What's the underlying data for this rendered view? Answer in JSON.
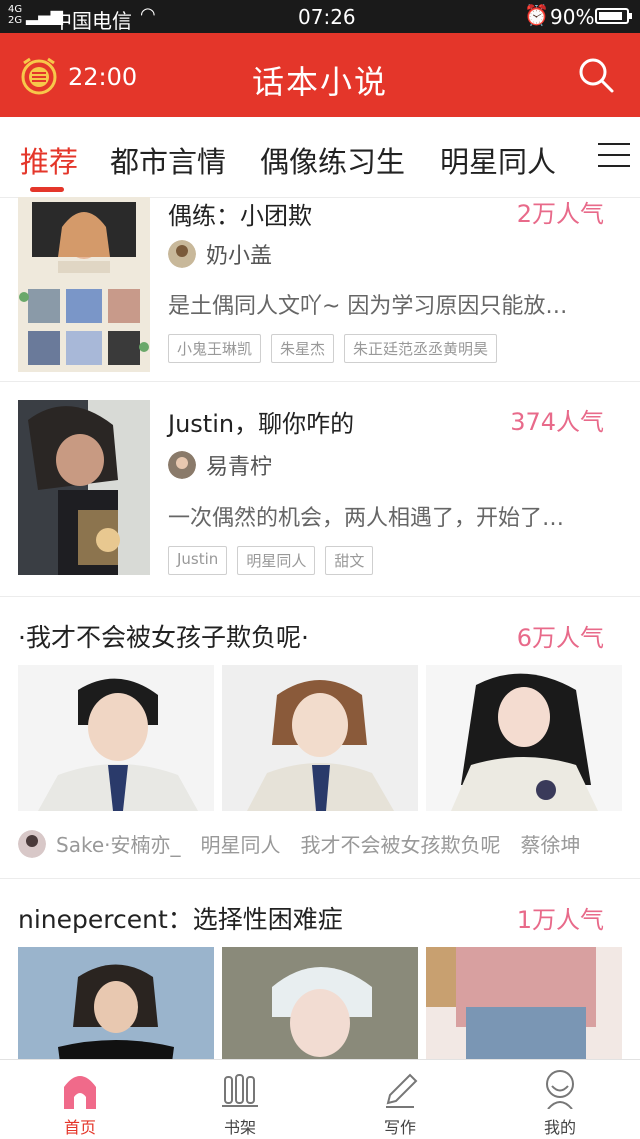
{
  "status_bar": {
    "signal_top": "4G",
    "signal_bottom": "2G",
    "carrier": "中国电信",
    "time": "07:26",
    "battery": "90%",
    "battery_level": 0.9
  },
  "app_bar": {
    "timer": "22:00",
    "title": "话本小说"
  },
  "tabs": [
    {
      "label": "推荐",
      "active": true
    },
    {
      "label": "都市言情",
      "active": false
    },
    {
      "label": "偶像练习生",
      "active": false
    },
    {
      "label": "明星同人",
      "active": false
    }
  ],
  "books": [
    {
      "title": "偶练：小团欺",
      "popularity": "2万人气",
      "author": "奶小盖",
      "description": "是土偶同人文吖~ 因为学习原因只能放…",
      "tags": [
        "小鬼王琳凯",
        "朱星杰",
        "朱正廷范丞丞黄明昊"
      ]
    },
    {
      "title": "Justin，聊你咋的",
      "popularity": "374人气",
      "author": "易青柠",
      "description": "一次偶然的机会，两人相遇了，开始了…",
      "tags": [
        "Justin",
        "明星同人",
        "甜文"
      ]
    }
  ],
  "galleries": [
    {
      "title": "·我才不会被女孩子欺负呢·",
      "popularity": "6万人气",
      "author": "Sake·安楠亦_",
      "category": "明星同人",
      "series": "我才不会被女孩欺负呢",
      "character": "蔡徐坤"
    },
    {
      "title": "ninepercent：选择性困难症",
      "popularity": "1万人气"
    }
  ],
  "bottom_nav": [
    {
      "label": "首页",
      "icon": "home-icon",
      "active": true
    },
    {
      "label": "书架",
      "icon": "bookshelf-icon",
      "active": false
    },
    {
      "label": "写作",
      "icon": "pencil-icon",
      "active": false
    },
    {
      "label": "我的",
      "icon": "profile-icon",
      "active": false
    }
  ],
  "colors": {
    "brand_red": "#e4362a",
    "popularity_pink": "#e86a8a"
  }
}
